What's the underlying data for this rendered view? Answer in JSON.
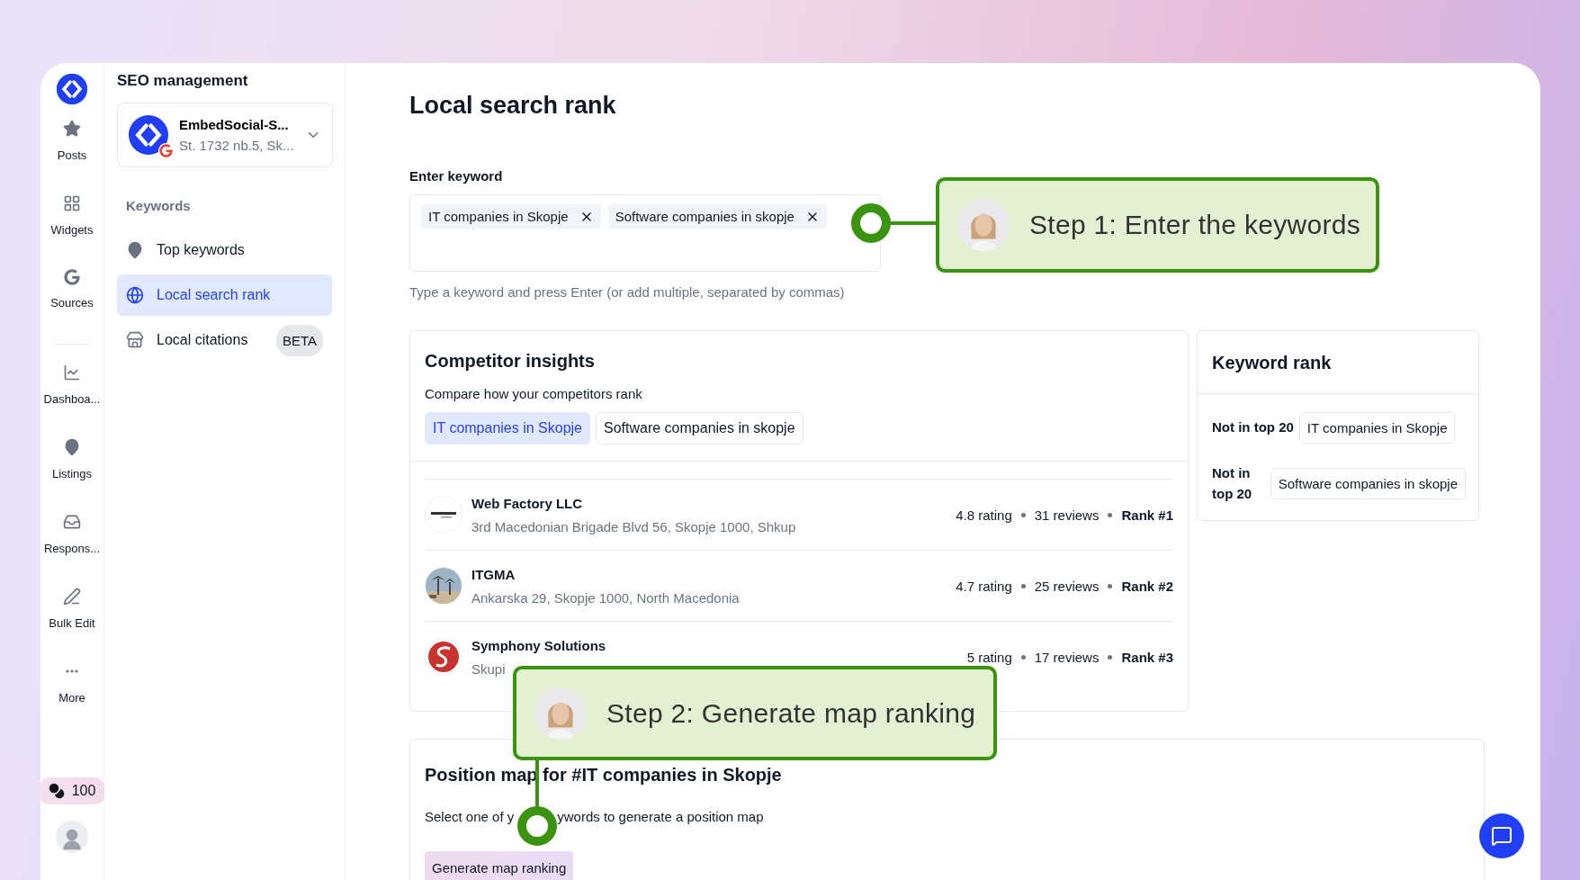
{
  "rail": {
    "items": [
      {
        "label": "Posts",
        "kind": "star"
      },
      {
        "label": "Widgets",
        "kind": "widgets"
      },
      {
        "label": "Sources",
        "kind": "google"
      },
      {
        "label": "Dashboa...",
        "kind": "chart"
      },
      {
        "label": "Listings",
        "kind": "pin"
      },
      {
        "label": "Respons...",
        "kind": "inbox"
      },
      {
        "label": "Bulk Edit",
        "kind": "edit"
      },
      {
        "label": "More",
        "kind": "more"
      }
    ],
    "credits": "100"
  },
  "sidebar": {
    "title": "SEO management",
    "account": {
      "name": "EmbedSocial-S...",
      "address": "St. 1732 nb.5, Sk..."
    },
    "section": "Keywords",
    "items": [
      {
        "label": "Top keywords",
        "kind": "pin",
        "selected": false
      },
      {
        "label": "Local search rank",
        "kind": "globe",
        "selected": true
      },
      {
        "label": "Local citations",
        "kind": "store",
        "selected": false,
        "badge": "BETA"
      }
    ]
  },
  "page": {
    "title": "Local search rank",
    "keyword_label": "Enter keyword",
    "tags": [
      "IT companies in Skopje",
      "Software companies in skopje"
    ],
    "hint": "Type a keyword and press Enter (or add multiple, separated by commas)"
  },
  "competitors": {
    "title": "Competitor insights",
    "subtitle": "Compare how your competitors rank",
    "filters": [
      {
        "label": "IT companies in Skopje",
        "selected": true
      },
      {
        "label": "Software companies in skopje",
        "selected": false
      }
    ],
    "rows": [
      {
        "name": "Web Factory LLC",
        "address": "3rd Macedonian Brigade Blvd 56, Skopje 1000, Shkup",
        "rating": "4.8 rating",
        "reviews": "31 reviews",
        "rank": "Rank #1",
        "kind": "wordmark"
      },
      {
        "name": "ITGMA",
        "address": "Ankarska 29, Skopje 1000, North Macedonia",
        "rating": "4.7 rating",
        "reviews": "25 reviews",
        "rank": "Rank #2"
      },
      {
        "name": "Symphony Solutions",
        "address": "Skupi",
        "rating": "5 rating",
        "reviews": "17 reviews",
        "rank": "Rank #3",
        "kind": "swirl"
      }
    ]
  },
  "keyword_rank": {
    "title": "Keyword rank",
    "rows": [
      {
        "status": "Not in top 20",
        "keyword": "IT companies in Skopje"
      },
      {
        "status": "Not in top 20",
        "keyword": "Software companies in skopje"
      }
    ]
  },
  "position_map": {
    "title": "Position map for #IT companies in Skopje",
    "text_before": "Select one of y",
    "text_after": "ywords to generate a position map",
    "button": "Generate map ranking"
  },
  "callouts": [
    {
      "text": "Step 1: Enter the keywords"
    },
    {
      "text": "Step 2: Generate map ranking"
    }
  ]
}
